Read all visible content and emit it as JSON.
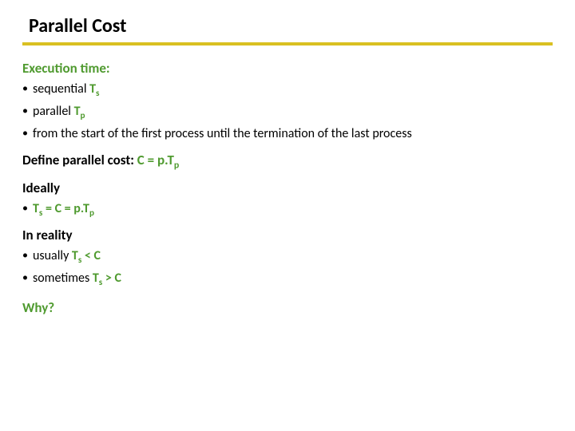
{
  "title": "Parallel Cost",
  "exec_time_label": "Execution time:",
  "bullets": {
    "sequential_word": "sequential ",
    "parallel_word": "parallel ",
    "from_note": "from the start of the first process until the termination of the last process",
    "usually_prefix": "usually ",
    "sometimes_prefix": "sometimes "
  },
  "define_label_plain": "Define parallel cost:",
  "define_expr_prefix": " C = p.T",
  "ideally_label": "Ideally",
  "ideally_expr_mid": " = C = p.T",
  "reality_label": "In reality",
  "lt": " < C",
  "gt": " > C",
  "T": "T",
  "sub_s": "s",
  "sub_p": "p",
  "why": "Why?",
  "bullet_char": "•"
}
